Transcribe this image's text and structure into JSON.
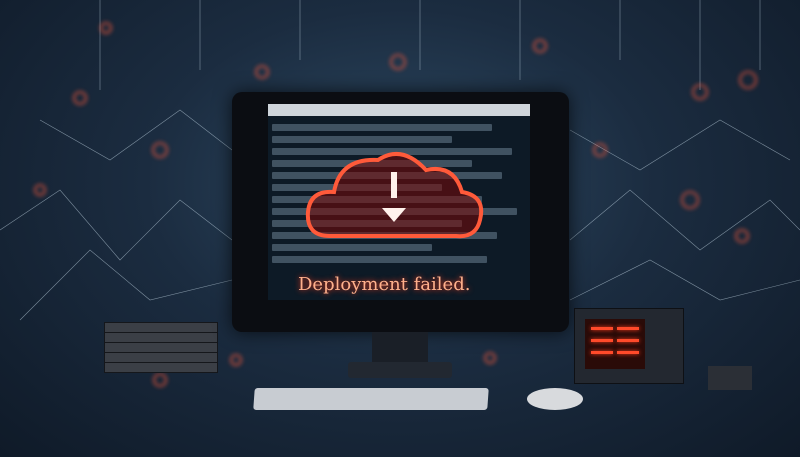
{
  "scene": {
    "error_message": "Deployment failed.",
    "icons": [
      "cloud-download-icon",
      "alert-icon"
    ],
    "colors": {
      "accent_red": "#ff3a1a",
      "glow": "#ff6b4a",
      "background_dark": "#0f1a28",
      "network_lines": "#cfe3f0"
    }
  }
}
